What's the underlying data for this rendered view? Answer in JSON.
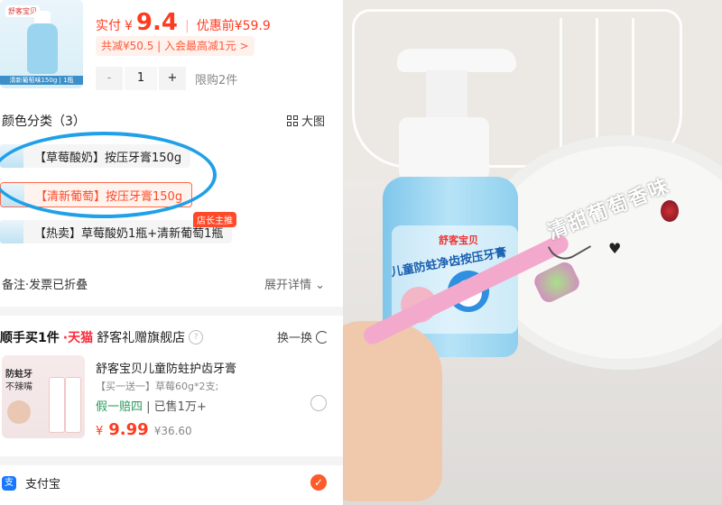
{
  "product": {
    "thumb_badge": "舒客宝贝",
    "thumb_caption": "清新葡萄味150g | 1瓶",
    "price_label": "实付",
    "price_currency": "¥",
    "price_value": "9.4",
    "pre_discount_label": "优惠前¥59.9",
    "promo_text": "共减¥50.5 | 入会最高减1元 >",
    "quantity": "1",
    "minus_label": "-",
    "plus_label": "+",
    "limit_text": "限购2件"
  },
  "color_section": {
    "title": "颜色分类（3）",
    "big_view_label": "大图",
    "options": [
      {
        "label": "【草莓酸奶】按压牙膏150g",
        "selected": false
      },
      {
        "label": "【清新葡萄】按压牙膏150g",
        "selected": true
      },
      {
        "label": "【热卖】草莓酸奶1瓶+清新葡萄1瓶",
        "selected": false
      }
    ],
    "recommend_tag": "店长主推"
  },
  "invoice": {
    "label": "备注·发票已折叠",
    "expand_label": "展开详情"
  },
  "side_buy": {
    "heading": "顺手买1件",
    "platform": "·天猫",
    "store": "舒客礼赠旗舰店",
    "qmark": "?",
    "swap_label": "换一换",
    "item": {
      "thumb_line1": "防蛀牙",
      "thumb_line2": "不辣嘴",
      "name": "舒客宝贝儿童防蛀护齿牙膏",
      "sub": "【买一送一】草莓60g*2支;",
      "guarantee": "假一赔四",
      "sold": "| 已售1万+",
      "price_currency": "¥",
      "price": "9.99",
      "original_price": "¥36.60"
    }
  },
  "payment": {
    "method": "支付宝",
    "icon_char": "支",
    "selected_mark": "✓"
  },
  "photo": {
    "brand_text": "舒客宝贝",
    "product_text": "儿童防蛀净齿按压牙膏",
    "handwriting": "清甜葡萄香味",
    "heart": "♥"
  },
  "colors": {
    "accent": "#ff3b1f",
    "annotation_ellipse": "#1fa0e8",
    "alipay": "#1677ff"
  }
}
